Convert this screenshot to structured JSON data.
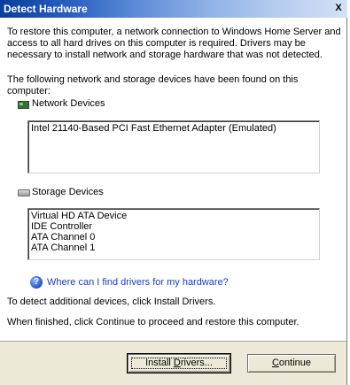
{
  "window": {
    "title": "Detect Hardware",
    "close_glyph": "X"
  },
  "intro_text": "To restore this computer, a network connection to Windows Home Server and access to all hard drives on this computer is required. Drivers may be necessary to install network and storage hardware that was not detected.",
  "found_text": "The following network and storage devices have been found on this computer:",
  "network": {
    "label": "Network Devices",
    "icon": "network-card-icon",
    "devices": [
      "Intel 21140-Based PCI Fast Ethernet Adapter (Emulated)"
    ]
  },
  "storage": {
    "label": "Storage Devices",
    "icon": "hard-drive-icon",
    "devices": [
      "Virtual HD ATA Device",
      "IDE Controller",
      "ATA Channel 0",
      "ATA Channel 1"
    ]
  },
  "help": {
    "icon": "help-icon",
    "link_text": "Where can I find drivers for my hardware?"
  },
  "detect_text": "To detect additional devices, click Install Drivers.",
  "finish_text": "When finished, click Continue to proceed and restore this computer.",
  "buttons": {
    "install_pre": "Install ",
    "install_mnemonic": "D",
    "install_post": "rivers...",
    "continue_mnemonic": "C",
    "continue_post": "ontinue"
  }
}
